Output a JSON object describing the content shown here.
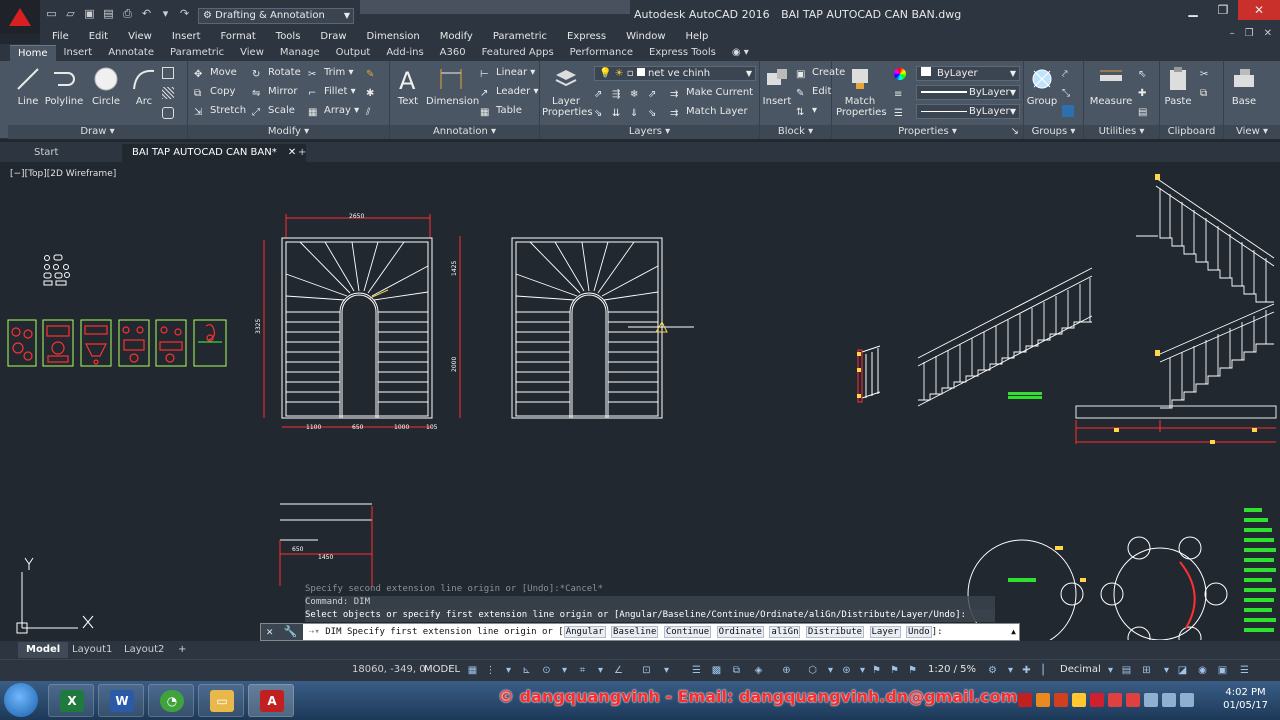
{
  "window": {
    "title_app": "Autodesk AutoCAD 2016",
    "title_file": "BAI TAP AUTOCAD CAN BAN.dwg",
    "workspace": "Drafting & Annotation"
  },
  "menu": [
    "File",
    "Edit",
    "View",
    "Insert",
    "Format",
    "Tools",
    "Draw",
    "Dimension",
    "Modify",
    "Parametric",
    "Express",
    "Window",
    "Help"
  ],
  "ribbon_tabs": [
    "Home",
    "Insert",
    "Annotate",
    "Parametric",
    "View",
    "Manage",
    "Output",
    "Add-ins",
    "A360",
    "Featured Apps",
    "Performance",
    "Express Tools"
  ],
  "ribbon": {
    "draw": {
      "title": "Draw",
      "line": "Line",
      "polyline": "Polyline",
      "circle": "Circle",
      "arc": "Arc"
    },
    "modify": {
      "title": "Modify",
      "move": "Move",
      "rotate": "Rotate",
      "trim": "Trim",
      "copy": "Copy",
      "mirror": "Mirror",
      "fillet": "Fillet",
      "stretch": "Stretch",
      "scale": "Scale",
      "array": "Array"
    },
    "annotation": {
      "title": "Annotation",
      "text": "Text",
      "dimension": "Dimension",
      "linear": "Linear",
      "leader": "Leader",
      "table": "Table"
    },
    "layers": {
      "title": "Layers",
      "layer_properties_1": "Layer",
      "layer_properties_2": "Properties",
      "current_layer": "net ve chinh",
      "make_current": "Make Current",
      "match_layer": "Match Layer"
    },
    "block": {
      "title": "Block",
      "insert": "Insert",
      "create": "Create",
      "edit": "Edit"
    },
    "properties": {
      "title": "Properties",
      "match_1": "Match",
      "match_2": "Properties",
      "color": "ByLayer",
      "linetype": "ByLayer",
      "lineweight": "ByLayer"
    },
    "groups": {
      "title": "Groups",
      "group": "Group"
    },
    "utilities": {
      "title": "Utilities",
      "measure": "Measure"
    },
    "clipboard": {
      "title": "Clipboard",
      "paste": "Paste"
    },
    "view": {
      "title": "View",
      "base": "Base"
    }
  },
  "file_tabs": {
    "start": "Start",
    "active": "BAI TAP AUTOCAD CAN BAN*"
  },
  "viewport": {
    "label": "[−][Top][2D Wireframe]",
    "dims": {
      "top": "2650",
      "right_top": "1425",
      "left": "3325",
      "right_bottom": "2000",
      "b1": "1100",
      "b2": "650",
      "b3": "1000",
      "b4": "105",
      "small1": "650",
      "small2": "1450"
    }
  },
  "command": {
    "history_1": "Specify second extension line origin or [Undo]:*Cancel*",
    "history_2": "Command:  DIM",
    "history_3": "Select objects or specify first extension line origin or [Angular/Baseline/Continue/Ordinate/aliGn/Distribute/Layer/Undo]:",
    "prompt_prefix": "DIM Specify first extension line origin or [",
    "options": [
      "Angular",
      "Baseline",
      "Continue",
      "Ordinate",
      "aliGn",
      "Distribute",
      "Layer",
      "Undo"
    ],
    "prompt_suffix": "]:"
  },
  "layout_tabs": [
    "Model",
    "Layout1",
    "Layout2"
  ],
  "status": {
    "coords": "18060, -349, 0",
    "model": "MODEL",
    "scale": "1:20 / 5%",
    "units": "Decimal"
  },
  "taskbar": {
    "watermark": "© dangquangvinh - Email: dangquangvinh.dn@gmail.com",
    "time": "4:02 PM",
    "date": "01/05/17"
  },
  "colors": {
    "accent_red": "#d92020",
    "cad_bg": "#212830",
    "ribbon": "#4a5663"
  }
}
